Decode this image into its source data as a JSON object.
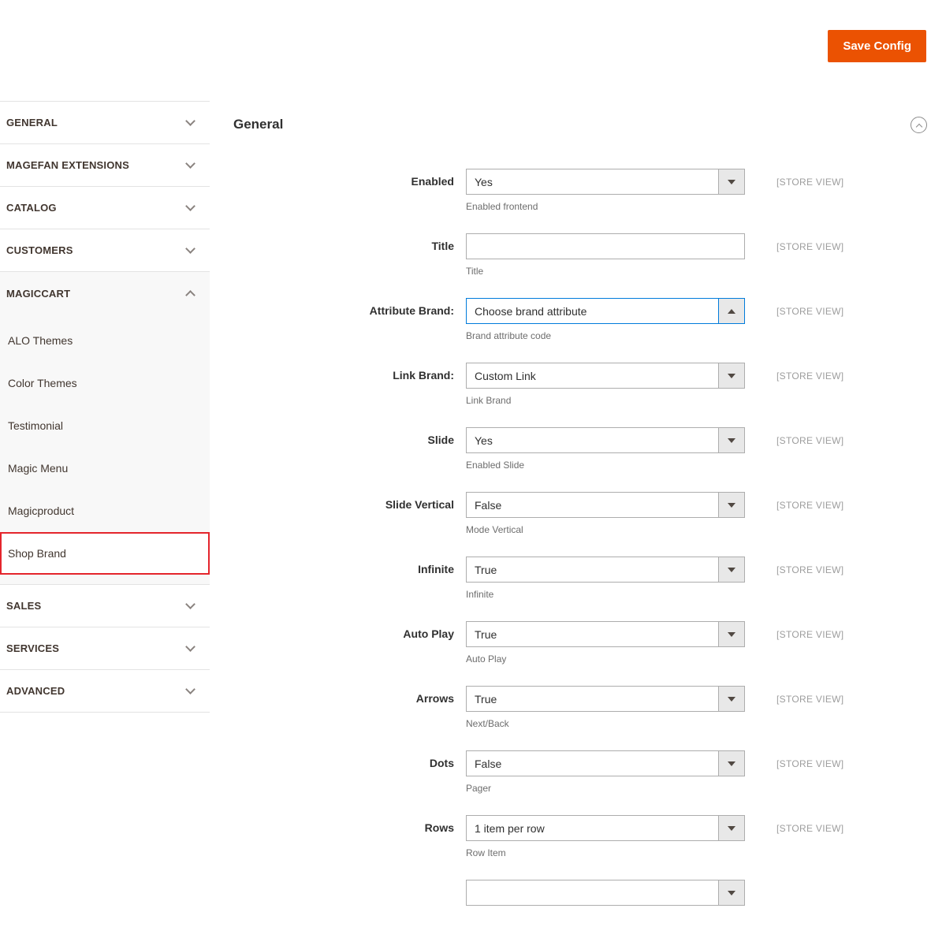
{
  "colors": {
    "save_button": "#eb5202",
    "focus_border": "#007bdb",
    "highlight_border": "#e4252c"
  },
  "header": {
    "save_label": "Save Config"
  },
  "sidebar": {
    "sections": [
      {
        "label": "GENERAL",
        "expanded": false
      },
      {
        "label": "MAGEFAN EXTENSIONS",
        "expanded": false
      },
      {
        "label": "CATALOG",
        "expanded": false
      },
      {
        "label": "CUSTOMERS",
        "expanded": false
      },
      {
        "label": "MAGICCART",
        "expanded": true,
        "items": [
          "ALO Themes",
          "Color Themes",
          "Testimonial",
          "Magic Menu",
          "Magicproduct",
          "Shop Brand"
        ],
        "selected_item": "Shop Brand"
      },
      {
        "label": "SALES",
        "expanded": false
      },
      {
        "label": "SERVICES",
        "expanded": false
      },
      {
        "label": "ADVANCED",
        "expanded": false
      }
    ]
  },
  "main": {
    "section_title": "General",
    "fields": [
      {
        "label": "Enabled",
        "type": "select",
        "value": "Yes",
        "hint": "Enabled frontend",
        "scope": "[STORE VIEW]",
        "focused": false
      },
      {
        "label": "Title",
        "type": "text",
        "value": "",
        "hint": "Title",
        "scope": "[STORE VIEW]",
        "focused": false
      },
      {
        "label": "Attribute Brand:",
        "type": "select",
        "value": "Choose brand attribute",
        "hint": "Brand attribute code",
        "scope": "[STORE VIEW]",
        "focused": true
      },
      {
        "label": "Link Brand:",
        "type": "select",
        "value": "Custom Link",
        "hint": "Link Brand",
        "scope": "[STORE VIEW]",
        "focused": false
      },
      {
        "label": "Slide",
        "type": "select",
        "value": "Yes",
        "hint": "Enabled Slide",
        "scope": "[STORE VIEW]",
        "focused": false
      },
      {
        "label": "Slide Vertical",
        "type": "select",
        "value": "False",
        "hint": "Mode Vertical",
        "scope": "[STORE VIEW]",
        "focused": false
      },
      {
        "label": "Infinite",
        "type": "select",
        "value": "True",
        "hint": "Infinite",
        "scope": "[STORE VIEW]",
        "focused": false
      },
      {
        "label": "Auto Play",
        "type": "select",
        "value": "True",
        "hint": "Auto Play",
        "scope": "[STORE VIEW]",
        "focused": false
      },
      {
        "label": "Arrows",
        "type": "select",
        "value": "True",
        "hint": "Next/Back",
        "scope": "[STORE VIEW]",
        "focused": false
      },
      {
        "label": "Dots",
        "type": "select",
        "value": "False",
        "hint": "Pager",
        "scope": "[STORE VIEW]",
        "focused": false
      },
      {
        "label": "Rows",
        "type": "select",
        "value": "1 item per row",
        "hint": "Row Item",
        "scope": "[STORE VIEW]",
        "focused": false
      },
      {
        "label": "",
        "type": "select",
        "value": "",
        "hint": "",
        "scope": "",
        "focused": false
      }
    ]
  }
}
